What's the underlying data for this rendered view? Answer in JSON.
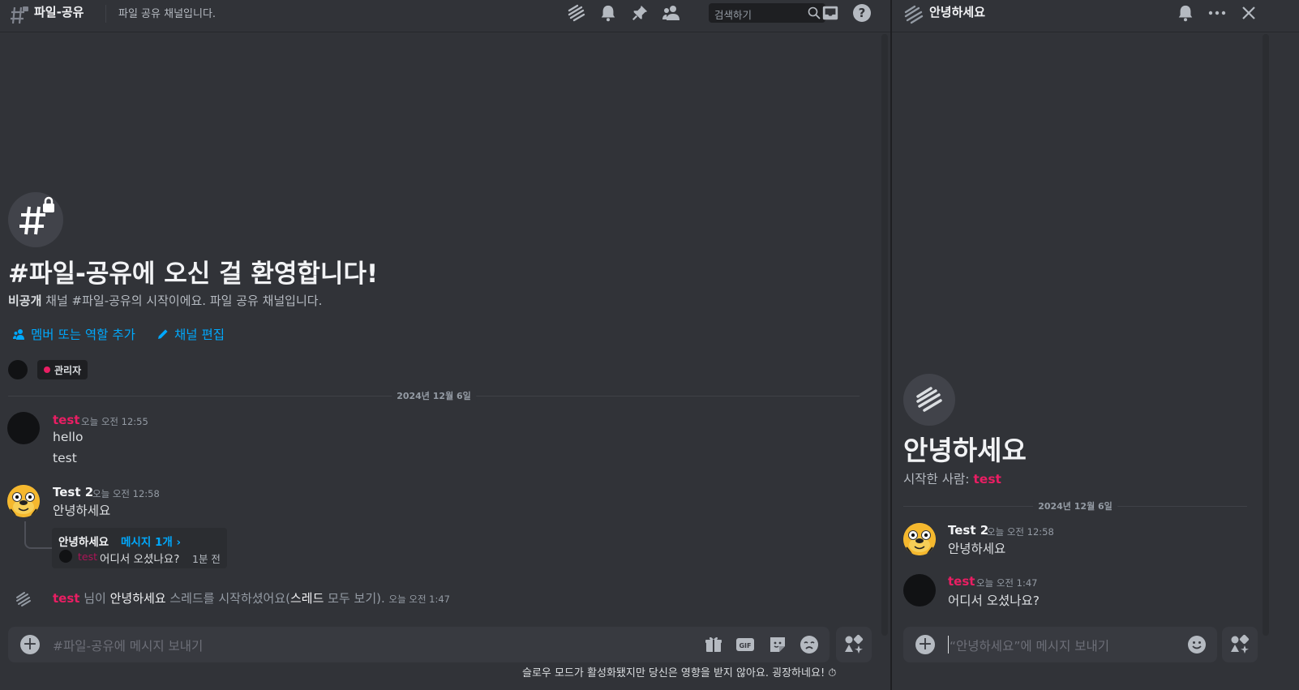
{
  "channel": {
    "name": "파일-공유",
    "topic": "파일 공유 채널입니다.",
    "search_placeholder": "검색하기"
  },
  "welcome": {
    "title": "#파일-공유에 오신 걸 환영합니다!",
    "private_label": "비공개",
    "subtitle_rest": " 채널 #파일-공유의 시작이에요. 파일 공유 채널입니다.",
    "add_members": "멤버 또는 역할 추가",
    "edit_channel": "채널 편집",
    "role": "관리자"
  },
  "date_separator": "2024년 12월 6일",
  "messages": [
    {
      "user": "test",
      "time": "오늘 오전 12:55",
      "lines": [
        "hello",
        "test"
      ]
    },
    {
      "user": "Test 2",
      "time": "오늘 오전 12:58",
      "lines": [
        "안녕하세요"
      ]
    }
  ],
  "thread_preview": {
    "name": "안녕하세요",
    "count": "메시지 1개 ›",
    "last_user": "test",
    "last_message": "어디서 오셨나요?",
    "last_time": "1분 전"
  },
  "system_message": {
    "user": "test",
    "part1": " 님이 ",
    "thread": "안녕하세요",
    "part2": " 스레드를 시작하셨어요(",
    "see_all": "스레드",
    "part3": " 모두 보기).",
    "time": "오늘 오전 1:47"
  },
  "composer": {
    "placeholder": "#파일-공유에 메시지 보내기",
    "gif_label": "GIF"
  },
  "slowmode_notice": "슬로우 모드가 활성화됐지만 당신은 영향을 받지 않아요. 굉장하네요!",
  "thread_panel": {
    "title": "안녕하세요",
    "big_title": "안녕하세요",
    "started_by_label": "시작한 사람: ",
    "started_by": "test",
    "date_separator": "2024년 12월 6일",
    "messages": [
      {
        "user": "Test 2",
        "time": "오늘 오전 12:58",
        "text": "안녕하세요"
      },
      {
        "user": "test",
        "time": "오늘 오전 1:47",
        "text": "어디서 오셨나요?"
      }
    ],
    "composer_placeholder": "“안녕하세요”에 메시지 보내기"
  },
  "colors": {
    "background": "#313338",
    "accent_link": "#00a8fc",
    "username_pink": "#e91e63",
    "composer_bg": "#383a40"
  }
}
